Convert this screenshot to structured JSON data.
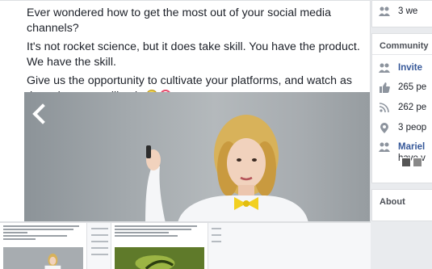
{
  "post": {
    "line1": "Ever wondered how to get the most out of your social media channels?",
    "line2": "It's not rocket science, but it does take skill. You have the product. We have the skill.",
    "line3": "Give us the opportunity to cultivate your platforms, and watch as the sales start rolling in"
  },
  "photo": {
    "prev_icon": "chevron-left-icon"
  },
  "sidebar": {
    "top_text": "3 we",
    "community_title": "Community",
    "invite_label": "Invite",
    "likes_text": "265 pe",
    "follows_text": "262 pe",
    "checkins_text": "3 peop",
    "friend_name": "Mariel",
    "friend_sub": "have v",
    "about_title": "About"
  }
}
